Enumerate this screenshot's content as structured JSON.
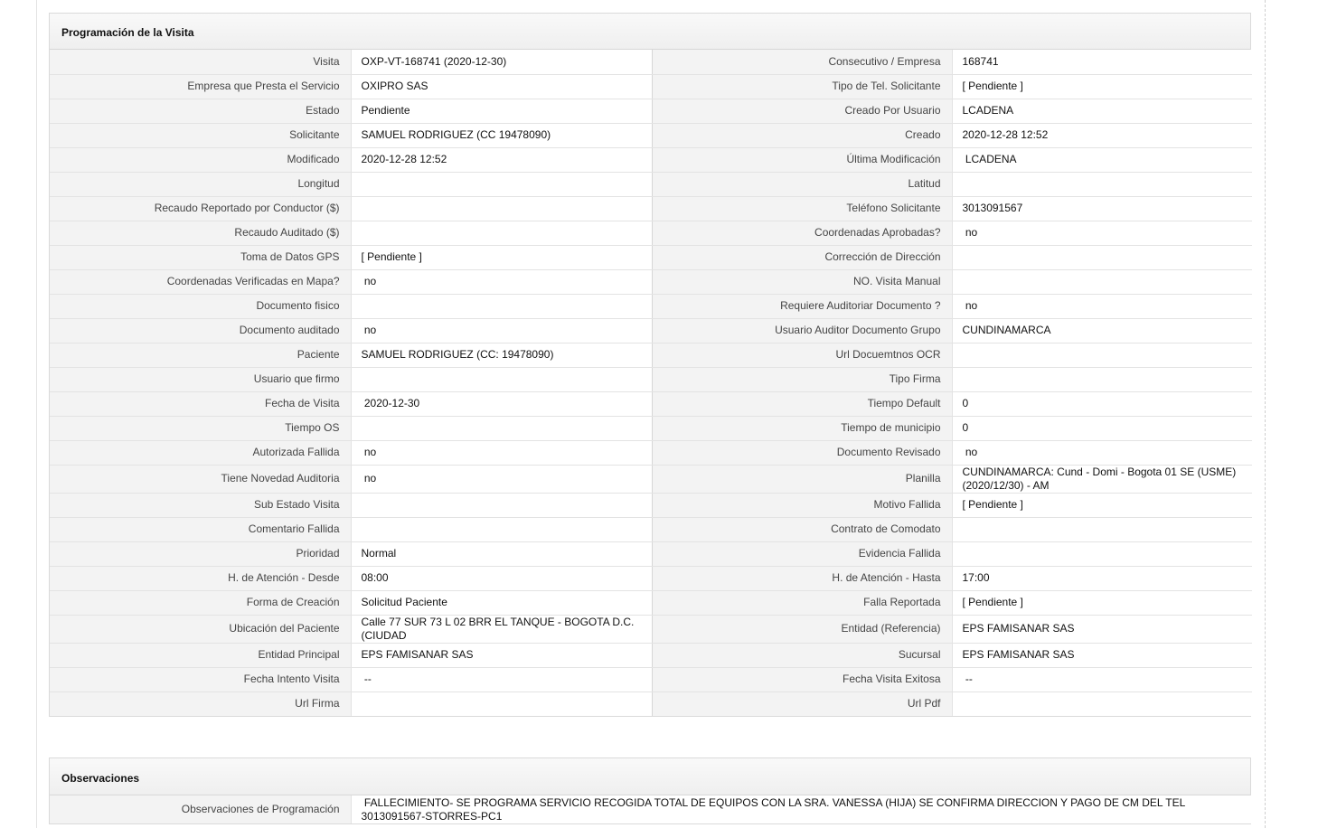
{
  "programacion": {
    "title": "Programación de la Visita",
    "rows": [
      {
        "l1": "Visita",
        "v1": "OXP-VT-168741 (2020-12-30)",
        "l2": "Consecutivo / Empresa",
        "v2": "168741"
      },
      {
        "l1": "Empresa que Presta el Servicio",
        "v1": "OXIPRO SAS",
        "l2": "Tipo de Tel. Solicitante",
        "v2": "[ Pendiente ]"
      },
      {
        "l1": "Estado",
        "v1": "Pendiente",
        "l2": "Creado Por Usuario",
        "v2": "LCADENA"
      },
      {
        "l1": "Solicitante",
        "v1": "SAMUEL RODRIGUEZ (CC 19478090)",
        "l2": "Creado",
        "v2": "2020-12-28 12:52"
      },
      {
        "l1": "Modificado",
        "v1": "2020-12-28 12:52",
        "l2": "Última Modificación",
        "v2": " LCADENA"
      },
      {
        "l1": "Longitud",
        "v1": "",
        "l2": "Latitud",
        "v2": ""
      },
      {
        "l1": "Recaudo Reportado por Conductor ($)",
        "v1": "",
        "l2": "Teléfono Solicitante",
        "v2": "3013091567"
      },
      {
        "l1": "Recaudo Auditado ($)",
        "v1": "",
        "l2": "Coordenadas Aprobadas?",
        "v2": " no"
      },
      {
        "l1": "Toma de Datos GPS",
        "v1": "[ Pendiente ]",
        "l2": "Corrección de Dirección",
        "v2": ""
      },
      {
        "l1": "Coordenadas Verificadas en Mapa?",
        "v1": " no",
        "l2": "NO. Visita Manual",
        "v2": ""
      },
      {
        "l1": "Documento fisico",
        "v1": "",
        "l2": "Requiere Auditoriar Documento ?",
        "v2": " no"
      },
      {
        "l1": "Documento auditado",
        "v1": " no",
        "l2": "Usuario Auditor Documento Grupo",
        "v2": "CUNDINAMARCA"
      },
      {
        "l1": "Paciente",
        "v1": "SAMUEL RODRIGUEZ (CC: 19478090)",
        "l2": "Url Docuemtnos OCR",
        "v2": ""
      },
      {
        "l1": "Usuario que firmo",
        "v1": "",
        "l2": "Tipo Firma",
        "v2": ""
      },
      {
        "l1": "Fecha de Visita",
        "v1": " 2020-12-30",
        "l2": "Tiempo Default",
        "v2": "0"
      },
      {
        "l1": "Tiempo OS",
        "v1": "",
        "l2": "Tiempo de municipio",
        "v2": "0"
      },
      {
        "l1": "Autorizada Fallida",
        "v1": " no",
        "l2": "Documento Revisado",
        "v2": " no"
      },
      {
        "l1": "Tiene Novedad Auditoria",
        "v1": " no",
        "l2": "Planilla",
        "v2": "CUNDINAMARCA: Cund - Domi - Bogota 01 SE (USME) (2020/12/30) - AM"
      },
      {
        "l1": "Sub Estado Visita",
        "v1": "",
        "l2": "Motivo Fallida",
        "v2": "[ Pendiente ]"
      },
      {
        "l1": "Comentario Fallida",
        "v1": "",
        "l2": "Contrato de Comodato",
        "v2": ""
      },
      {
        "l1": "Prioridad",
        "v1": "Normal",
        "l2": "Evidencia Fallida",
        "v2": ""
      },
      {
        "l1": "H. de Atención - Desde",
        "v1": "08:00",
        "l2": "H. de Atención - Hasta",
        "v2": "17:00"
      },
      {
        "l1": "Forma de Creación",
        "v1": "Solicitud Paciente",
        "l2": "Falla Reportada",
        "v2": "[ Pendiente ]"
      },
      {
        "l1": "Ubicación del Paciente",
        "v1": "Calle 77 SUR 73 L 02 BRR EL TANQUE - BOGOTA D.C. (CIUDAD",
        "l2": "Entidad (Referencia)",
        "v2": "EPS FAMISANAR SAS"
      },
      {
        "l1": "Entidad Principal",
        "v1": "EPS FAMISANAR SAS",
        "l2": "Sucursal",
        "v2": "EPS FAMISANAR SAS"
      },
      {
        "l1": "Fecha Intento Visita",
        "v1": " --",
        "l2": "Fecha Visita Exitosa",
        "v2": " --"
      },
      {
        "l1": "Url Firma",
        "v1": "",
        "l2": "Url Pdf",
        "v2": ""
      }
    ]
  },
  "observaciones": {
    "title": "Observaciones",
    "label": "Observaciones de Programación",
    "value": " FALLECIMIENTO- SE PROGRAMA SERVICIO RECOGIDA TOTAL DE EQUIPOS CON LA SRA. VANESSA (HIJA) SE CONFIRMA DIRECCION Y PAGO DE CM DEL TEL 3013091567-STORRES-PC1"
  }
}
